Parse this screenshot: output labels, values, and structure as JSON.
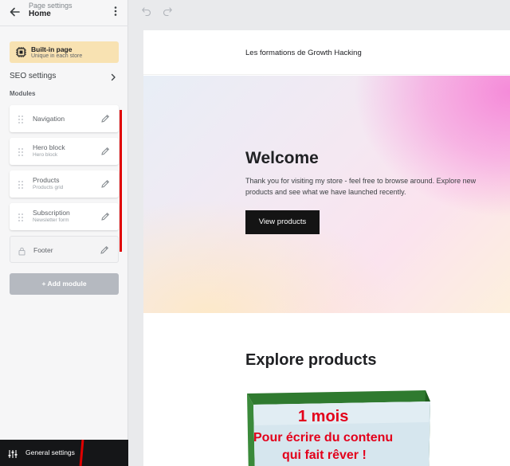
{
  "header": {
    "subtitle": "Page settings",
    "title": "Home",
    "back_icon": "arrow-left-icon",
    "more_icon": "more-vertical-icon"
  },
  "builtin": {
    "title": "Built-in page",
    "subtitle": "Unique in each store",
    "icon": "chip-icon",
    "color": "#f8e2b2"
  },
  "seo": {
    "label": "SEO settings",
    "icon": "chevron-right-icon"
  },
  "modules": {
    "title": "Modules",
    "items": [
      {
        "label": "Navigation",
        "sub": ""
      },
      {
        "label": "Hero block",
        "sub": "Hero block"
      },
      {
        "label": "Products",
        "sub": "Products grid"
      },
      {
        "label": "Subscription",
        "sub": "Newsletter form"
      },
      {
        "label": "Footer",
        "sub": "",
        "locked": true
      }
    ],
    "add_label": "+ Add module"
  },
  "footer": {
    "general_settings": "General settings",
    "icon": "sliders-icon"
  },
  "toolbar": {
    "undo_icon": "undo-icon",
    "redo_icon": "redo-icon"
  },
  "preview": {
    "store_name": "Les formations de Growth Hacking",
    "hero": {
      "title": "Welcome",
      "text": "Thank you for visiting my store - feel free to browse around. Explore new products and see what we have launched recently.",
      "button": "View products"
    },
    "explore_title": "Explore products",
    "product_image_lines": [
      "1 mois",
      "Pour écrire du contenu",
      "qui fait rêver !"
    ]
  },
  "colors": {
    "sidebar_bg": "#f6f6f7",
    "annotation_red": "#e00000",
    "button_dark": "#141414",
    "add_module_bg": "#b5b9c0"
  }
}
